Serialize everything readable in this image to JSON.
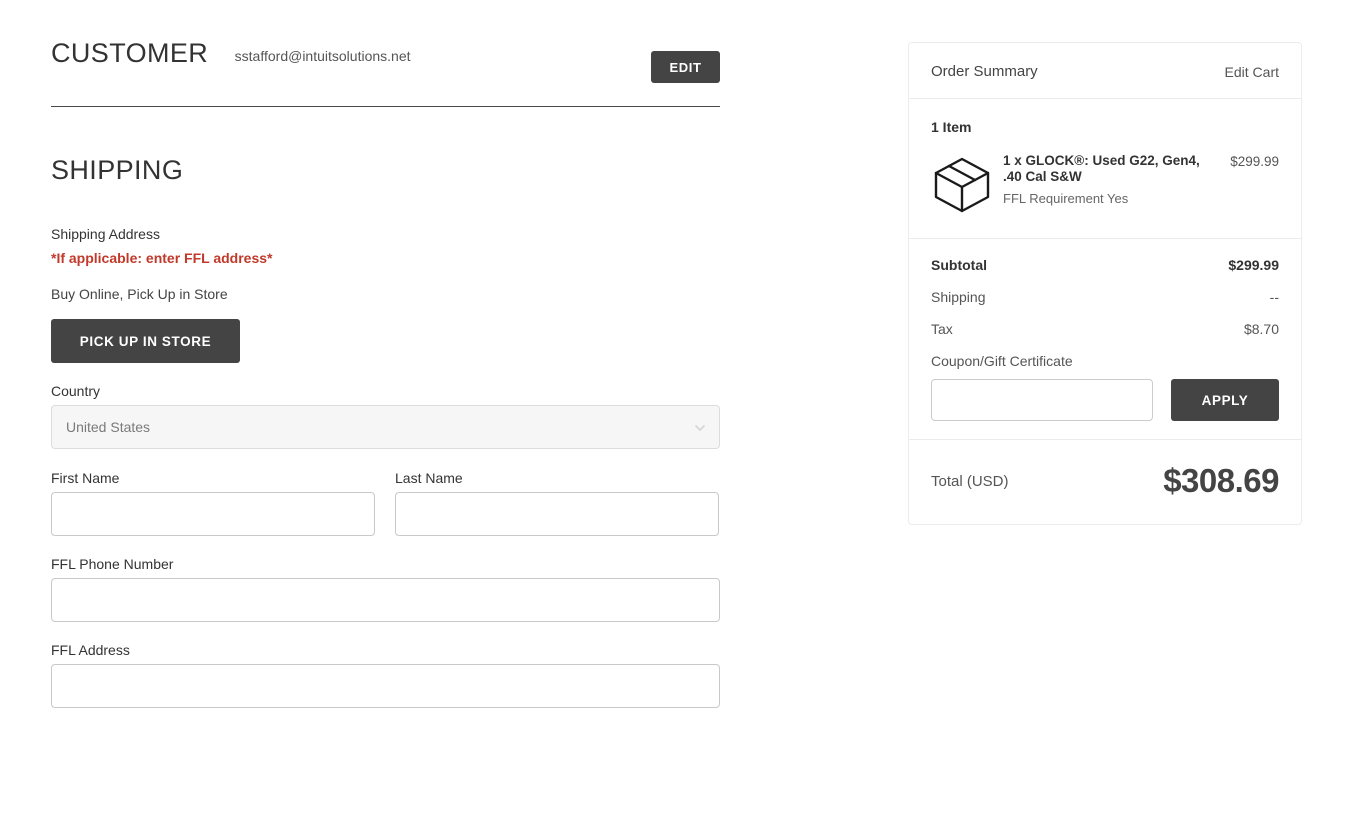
{
  "customer": {
    "heading": "CUSTOMER",
    "email": "sstafford@intuitsolutions.net",
    "edit_label": "EDIT"
  },
  "shipping": {
    "heading": "SHIPPING",
    "address_label": "Shipping Address",
    "ffl_warning": "*If applicable: enter FFL address*",
    "bopis_label": "Buy Online, Pick Up in Store",
    "pickup_button": "PICK UP IN STORE",
    "fields": {
      "country_label": "Country",
      "country_value": "United States",
      "first_name_label": "First Name",
      "first_name_value": "",
      "last_name_label": "Last Name",
      "last_name_value": "",
      "ffl_phone_label": "FFL Phone Number",
      "ffl_phone_value": "",
      "ffl_address_label": "FFL Address",
      "ffl_address_value": ""
    }
  },
  "order_summary": {
    "title": "Order Summary",
    "edit_cart_label": "Edit Cart",
    "item_count_label": "1 Item",
    "items": [
      {
        "name": "1 x GLOCK®: Used G22, Gen4, .40 Cal S&W",
        "meta": "FFL Requirement Yes",
        "price": "$299.99",
        "icon": "box-icon"
      }
    ],
    "totals": [
      {
        "label": "Subtotal",
        "value": "$299.99",
        "bold": true
      },
      {
        "label": "Shipping",
        "value": "--",
        "bold": false
      },
      {
        "label": "Tax",
        "value": "$8.70",
        "bold": false
      }
    ],
    "coupon_label": "Coupon/Gift Certificate",
    "coupon_value": "",
    "apply_label": "APPLY",
    "grand_total_label": "Total (USD)",
    "grand_total_value": "$308.69"
  },
  "colors": {
    "button_dark": "#444444",
    "warning_red": "#c0392b",
    "panel_border": "#ececec",
    "text_primary": "#333333"
  }
}
